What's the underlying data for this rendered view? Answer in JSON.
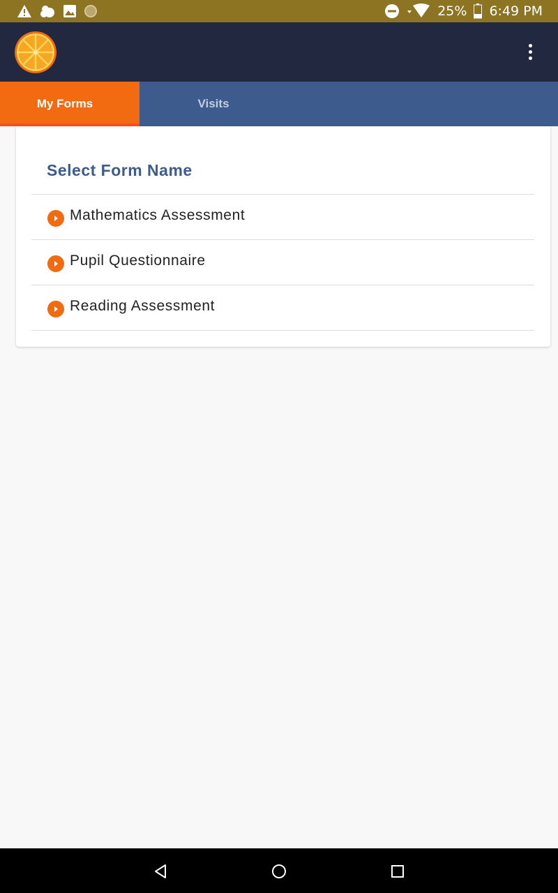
{
  "status_bar": {
    "battery_percent": "25%",
    "time": "6:49 PM",
    "icons_left": [
      "warning-icon",
      "weather-icon",
      "image-icon",
      "circle-icon"
    ],
    "icons_right": [
      "do-not-disturb-icon",
      "wifi-icon",
      "battery-icon"
    ]
  },
  "app_bar": {
    "logo": "orange-slice-logo",
    "menu": "overflow-menu-icon"
  },
  "tabs": [
    {
      "label": "My Forms",
      "active": true
    },
    {
      "label": "Visits",
      "active": false
    }
  ],
  "card": {
    "title": "Select Form Name",
    "items": [
      {
        "label": "Mathematics Assessment",
        "icon": "play-circle-icon"
      },
      {
        "label": "Pupil Questionnaire",
        "icon": "play-circle-icon"
      },
      {
        "label": "Reading Assessment",
        "icon": "play-circle-icon"
      }
    ]
  },
  "nav_bar": {
    "buttons": [
      "back-icon",
      "home-icon",
      "recents-icon"
    ]
  },
  "colors": {
    "status_bar": "#8c7422",
    "app_bar": "#212840",
    "tab_bar": "#3d5b8d",
    "tab_active": "#f26b10",
    "accent_orange": "#f26b10",
    "title_blue": "#3d5b8d"
  }
}
